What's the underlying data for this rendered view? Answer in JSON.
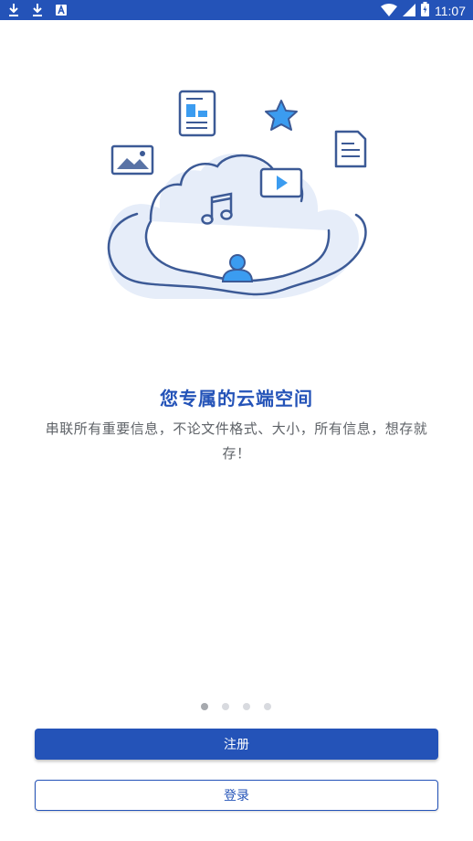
{
  "status_bar": {
    "time": "11:07",
    "notification_icons": [
      "download-icon",
      "download-icon",
      "a-icon"
    ],
    "system_icons": [
      "wifi-icon",
      "signal-icon",
      "battery-icon"
    ]
  },
  "onboarding": {
    "illustration_icons": [
      "cloud-icon",
      "document-icon",
      "star-icon",
      "image-icon",
      "file-icon",
      "video-icon",
      "music-icon",
      "user-icon"
    ],
    "title": "您专属的云端空间",
    "description": "串联所有重要信息，不论文件格式、大小，所有信息，想存就存！",
    "page_indicator": {
      "total": 4,
      "current": 1
    }
  },
  "actions": {
    "register_label": "注册",
    "login_label": "登录"
  },
  "colors": {
    "primary": "#2453b8",
    "illustration_stroke": "#3c5a96",
    "illustration_accent": "#3b9cf0",
    "text_secondary": "#5f6368",
    "dot_active": "#a6a9ae",
    "dot_inactive": "#d8dadf"
  }
}
